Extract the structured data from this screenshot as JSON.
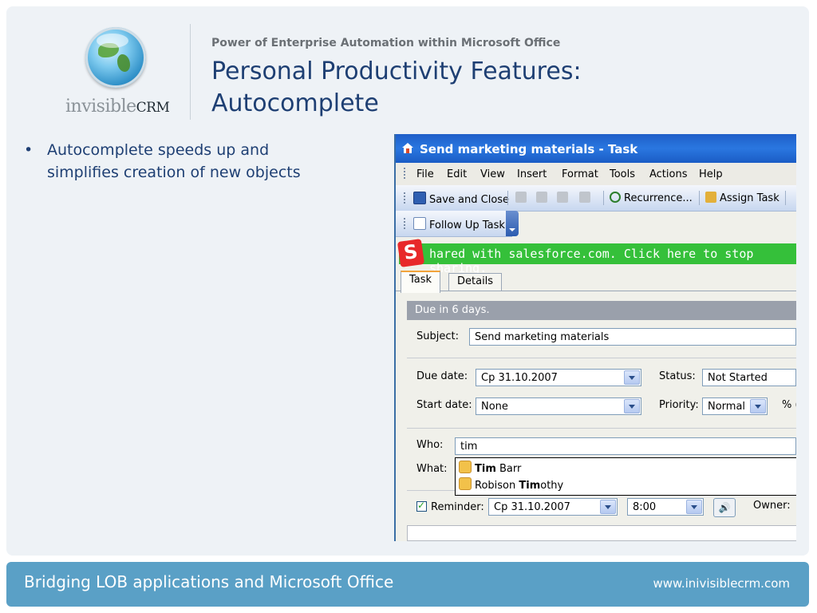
{
  "slide": {
    "logo_text": "invisible",
    "logo_bold": "CRM",
    "supertitle": "Power of Enterprise Automation within Microsoft Office",
    "title": "Personal Productivity Features: Autocomplete",
    "bullet_marker": "•",
    "bullet_text": "Autocomplete speeds up and simplifies creation of new objects"
  },
  "window": {
    "title": "Send marketing materials - Task",
    "menu": [
      "File",
      "Edit",
      "View",
      "Insert",
      "Format",
      "Tools",
      "Actions",
      "Help"
    ],
    "toolbar": {
      "save_close": "Save and Close",
      "recurrence": "Recurrence...",
      "assign_task": "Assign Task",
      "follow_up": "Follow Up Task"
    },
    "salesforce_bar": {
      "logo": "S",
      "text": "hared with salesforce.com. Click here to stop sharing."
    },
    "tabs": {
      "task": "Task",
      "details": "Details"
    },
    "due_banner": "Due in 6 days.",
    "subject_label": "Subject:",
    "subject_value": "Send marketing materials",
    "due_date_label": "Due date:",
    "due_date_value": "Cp 31.10.2007",
    "start_date_label": "Start date:",
    "start_date_value": "None",
    "status_label": "Status:",
    "status_value": "Not Started",
    "priority_label": "Priority:",
    "priority_value": "Normal",
    "percent_label": "% (",
    "who_label": "Who:",
    "who_value": "tim",
    "what_label": "What:",
    "autocomplete": [
      {
        "match": "Tim",
        "rest": " Barr",
        "prefix": ""
      },
      {
        "match": "Tim",
        "rest": "othy",
        "prefix": "Robison "
      }
    ],
    "reminder_label": "Reminder:",
    "reminder_date": "Cp 31.10.2007",
    "reminder_time": "8:00",
    "owner_label": "Owner:"
  },
  "footer": {
    "left": "Bridging LOB applications and Microsoft Office",
    "right": "www.inivisiblecrm.com"
  },
  "colors": {
    "title_blue": "#1e3f73",
    "footer_bg": "#5aa0c6",
    "salesforce_green": "#35c03a",
    "titlebar_blue": "#2a77e0"
  }
}
